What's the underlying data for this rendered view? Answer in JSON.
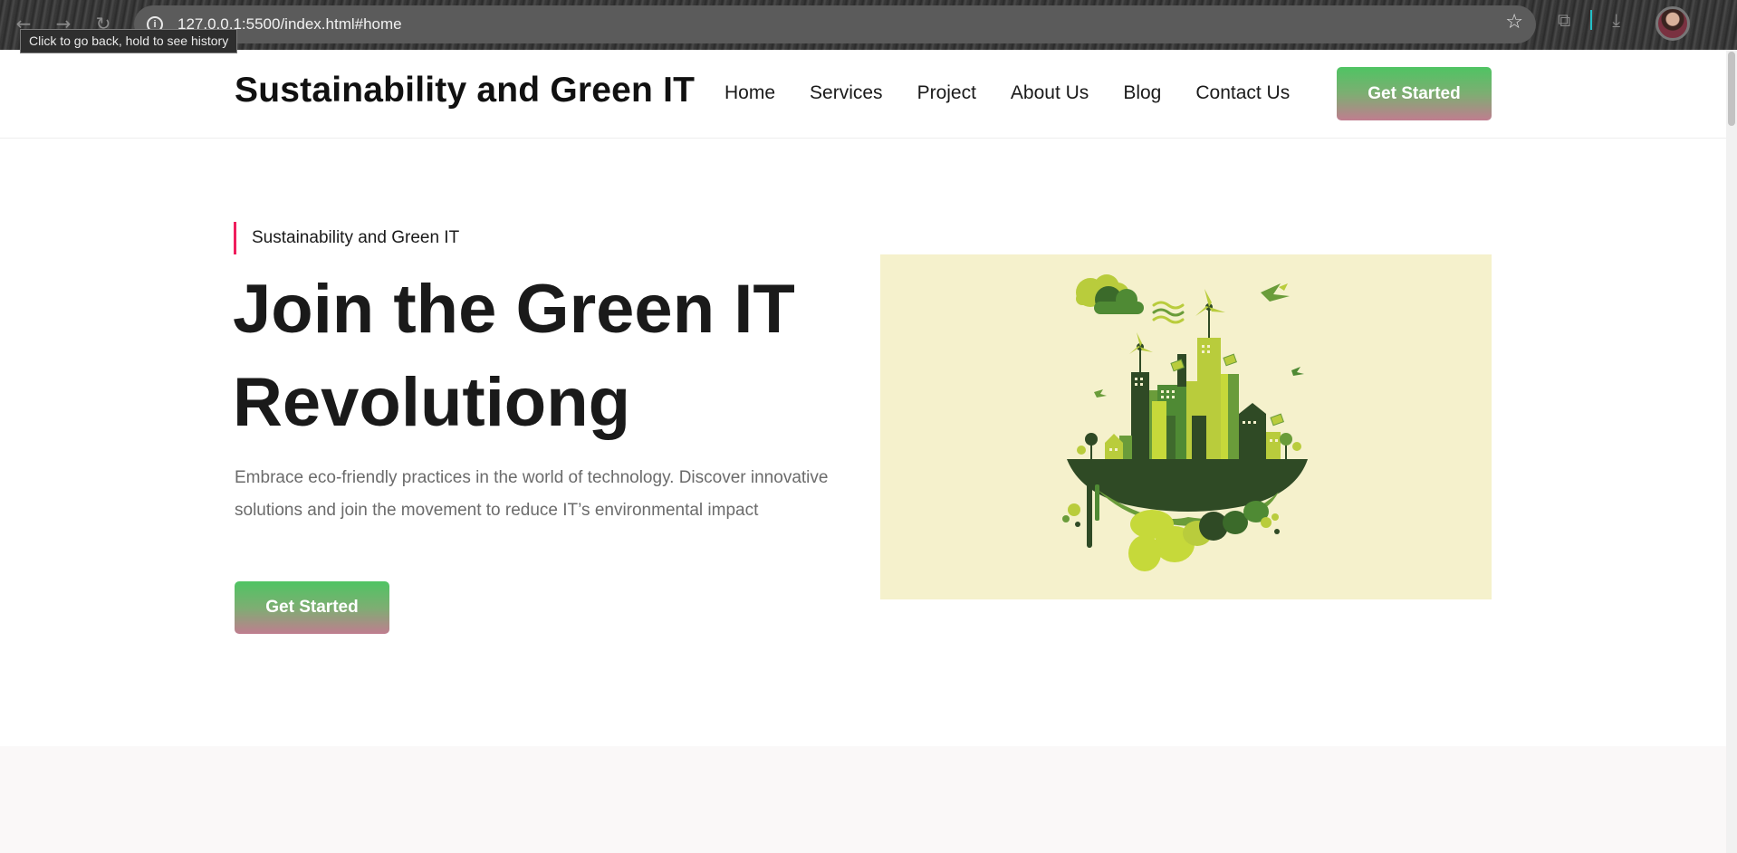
{
  "browser": {
    "url": "127.0.0.1:5500/index.html#home",
    "tooltip": "Click to go back, hold to see history",
    "icons": [
      "back-arrow-icon",
      "forward-arrow-icon",
      "reload-icon",
      "info-icon",
      "star-icon",
      "extensions-icon",
      "download-icon",
      "profile-avatar"
    ]
  },
  "header": {
    "brand": "Sustainability and Green IT",
    "nav": [
      "Home",
      "Services",
      "Project",
      "About Us",
      "Blog",
      "Contact Us"
    ],
    "cta": "Get Started"
  },
  "hero": {
    "eyebrow": "Sustainability and Green IT",
    "title_line1": "Join the Green IT",
    "title_line2": "Revolutiong",
    "description": "Embrace eco-friendly practices in the world of technology. Discover innovative solutions and join the movement to reduce IT’s environmental impact",
    "cta": "Get Started"
  },
  "colors": {
    "accent_bar": "#ef1e5d",
    "button_top": "#4fc463",
    "button_bottom": "#c07d8f",
    "illustration_bg": "#f5f1cc",
    "dark_green": "#2f4a25",
    "lime": "#c6d93a"
  }
}
